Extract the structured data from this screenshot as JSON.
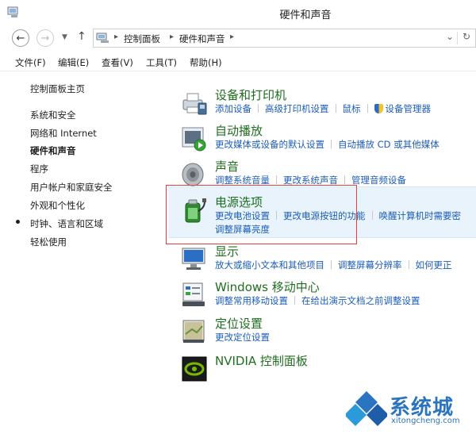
{
  "window": {
    "title": "硬件和声音"
  },
  "address": {
    "crumbs": [
      "控制面板",
      "硬件和声音"
    ],
    "dropdown_glyph": "⌄",
    "refresh_glyph": "↻"
  },
  "menu": [
    "文件(F)",
    "编辑(E)",
    "查看(V)",
    "工具(T)",
    "帮助(H)"
  ],
  "sidebar": {
    "items": [
      "控制面板主页",
      "系统和安全",
      "网络和 Internet",
      "硬件和声音",
      "程序",
      "用户帐户和家庭安全",
      "外观和个性化",
      "时钟、语言和区域",
      "轻松使用"
    ],
    "active_index": 3
  },
  "categories": [
    {
      "title": "设备和打印机",
      "links": [
        "添加设备",
        "高级打印机设置",
        "鼠标",
        "设备管理器"
      ],
      "icon": "printer-icon"
    },
    {
      "title": "自动播放",
      "links": [
        "更改媒体或设备的默认设置",
        "自动播放 CD 或其他媒体"
      ],
      "icon": "autoplay-icon"
    },
    {
      "title": "声音",
      "links": [
        "调整系统音量",
        "更改系统声音",
        "管理音频设备"
      ],
      "icon": "speaker-icon"
    },
    {
      "title": "电源选项",
      "links": [
        "更改电池设置",
        "更改电源按钮的功能",
        "唤醒计算机时需要密"
      ],
      "links2": [
        "调整屏幕亮度"
      ],
      "icon": "power-icon"
    },
    {
      "title": "显示",
      "links": [
        "放大或缩小文本和其他项目",
        "调整屏幕分辨率",
        "如何更正"
      ],
      "icon": "display-icon"
    },
    {
      "title": "Windows 移动中心",
      "links": [
        "调整常用移动设置",
        "在给出演示文档之前调整设置"
      ],
      "icon": "mobility-center-icon"
    },
    {
      "title": "定位设置",
      "links": [
        "更改定位设置"
      ],
      "icon": "location-icon"
    },
    {
      "title": "NVIDIA 控制面板",
      "links": [],
      "icon": "nvidia-icon"
    }
  ],
  "watermark": {
    "brand": "系统城",
    "url": "xitongcheng.com"
  },
  "colors": {
    "title_green": "#1f6e1f",
    "link_blue": "#1c5dba",
    "highlight_red": "#e0413a"
  }
}
